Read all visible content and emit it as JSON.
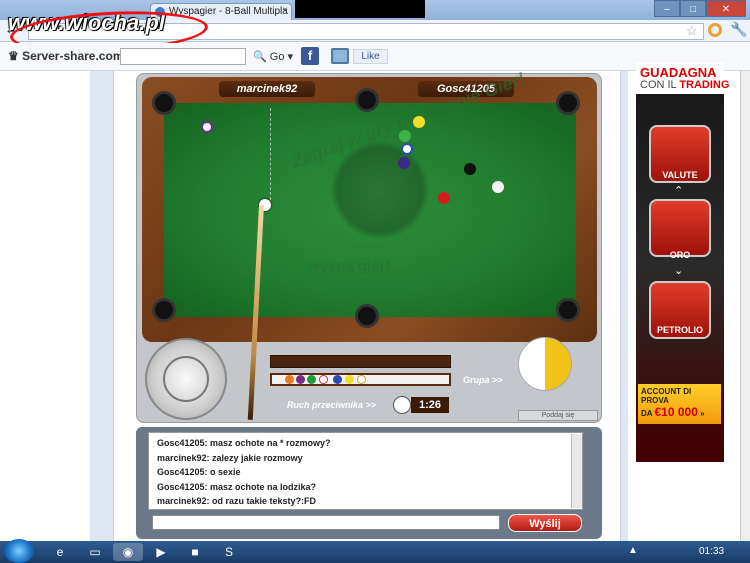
{
  "browser": {
    "tab_title": "Wyspagier - 8-Ball Multipla",
    "tab_close": "×",
    "back": "←",
    "window_buttons": [
      "–",
      "□",
      "✕"
    ],
    "star": "☆",
    "wrench": "🔧"
  },
  "watermark": "www.wiocha.pl",
  "bookmarks": {
    "site_logo": "Server-share.com",
    "go": "Go",
    "fb": "f",
    "like": "Like"
  },
  "game": {
    "player1": "marcinek92",
    "player2": "Gosc41205",
    "felt_text_top": "Zagraj w gry na Wyspie Gier!",
    "felt_text_bottom": "wyspa  gier!",
    "group_label": "Grupa >>",
    "move_label": "Ruch przeciwnika >>",
    "timer": "1:26",
    "concede": "Poddaj się"
  },
  "chat": {
    "lines": [
      "Gosc41205: masz ochote na * rozmowy?",
      "marcinek92: zalezy jakie rozmowy",
      "Gosc41205: o sexie",
      "Gosc41205: masz ochote na lodzika?",
      "marcinek92: od razu takie teksty?:FD"
    ],
    "send_label": "Wyślij"
  },
  "ad": {
    "headline": "GUADAGNA",
    "subline_pre": "CON IL ",
    "subline_bold": "TRADING",
    "items": [
      "VALUTE",
      "ORO",
      "PETROLIO"
    ],
    "cta_line1": "ACCOUNT DI PROVA",
    "cta_line2": "DA ",
    "cta_amount": "€10 000",
    "cta_arrow": "»"
  },
  "taskbar": {
    "time": "01:33"
  }
}
